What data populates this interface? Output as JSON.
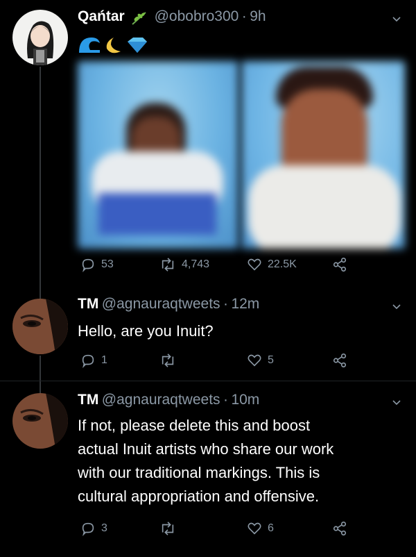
{
  "tweet1": {
    "name": "Qańtar",
    "handle": "@obobro300",
    "sep": "·",
    "time": "9h",
    "emoji_line": "🌊🌙💎",
    "stats": {
      "replies": "53",
      "retweets": "4,743",
      "likes": "22.5K"
    }
  },
  "reply1": {
    "name": "TM",
    "handle": "@agnauraqtweets",
    "sep": "·",
    "time": "12m",
    "text": "Hello, are you Inuit?",
    "stats": {
      "replies": "1",
      "likes": "5"
    }
  },
  "reply2": {
    "name": "TM",
    "handle": "@agnauraqtweets",
    "sep": "·",
    "time": "10m",
    "lines": [
      "If not, please delete this and boost",
      "actual Inuit artists who share our work",
      "with our traditional markings. This is",
      "cultural appropriation and offensive."
    ],
    "stats": {
      "replies": "3",
      "likes": "6"
    }
  },
  "icons": [
    "reply-icon",
    "retweet-icon",
    "like-icon",
    "share-icon",
    "chevron-down-icon",
    "leaf-emoji-icon"
  ],
  "colors": {
    "bg": "#000000",
    "muted": "#8b98a5",
    "line": "#333639"
  }
}
